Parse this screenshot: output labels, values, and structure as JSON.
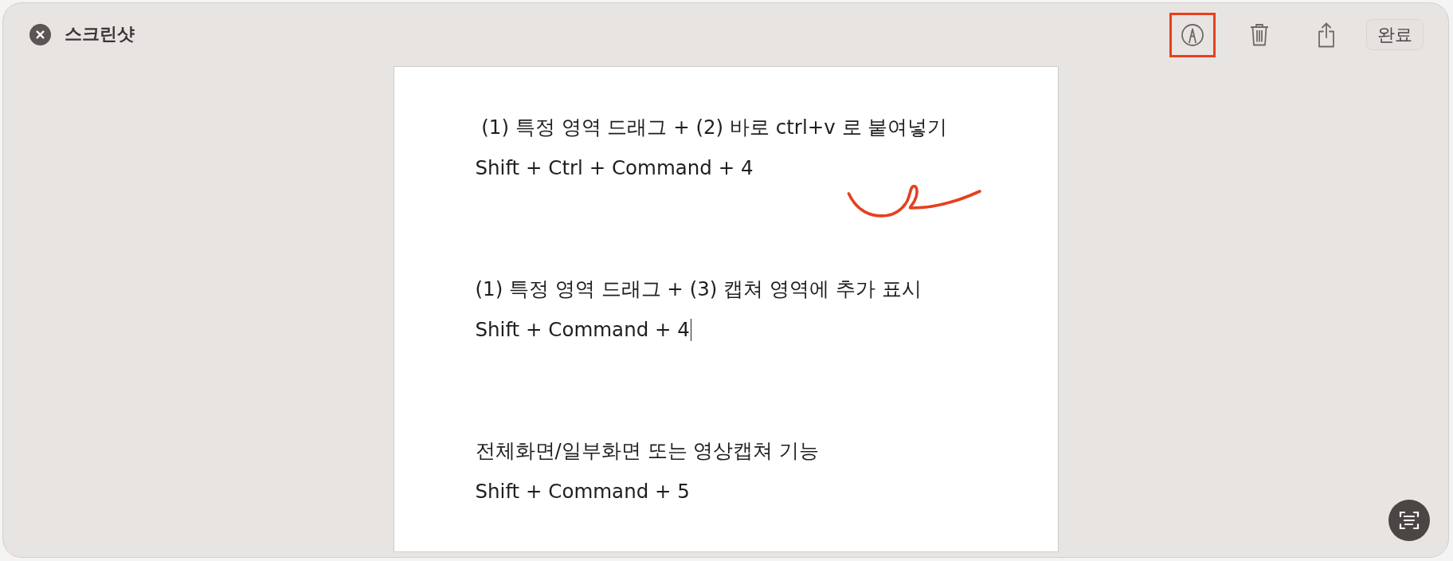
{
  "window": {
    "title": "스크린샷"
  },
  "toolbar": {
    "tools": [
      {
        "kind": "markup",
        "highlighted": true
      },
      {
        "kind": "delete",
        "highlighted": false
      },
      {
        "kind": "share",
        "highlighted": false
      }
    ],
    "done_button": {
      "label": "완료"
    }
  },
  "document": {
    "sections": [
      {
        "heading": " (1) 특정 영역 드래그 + (2) 바로 ctrl+v 로 붙여넣기",
        "shortcut": "Shift + Ctrl + Command + 4",
        "caret": false
      },
      {
        "heading": "(1) 특정 영역 드래그 + (3) 캡쳐 영역에 추가 표시",
        "shortcut": "Shift + Command + 4",
        "caret": true
      },
      {
        "heading": "전체화면/일부화면 또는 영상캡쳐 기능",
        "shortcut": "Shift + Command + 5",
        "caret": false
      }
    ]
  }
}
